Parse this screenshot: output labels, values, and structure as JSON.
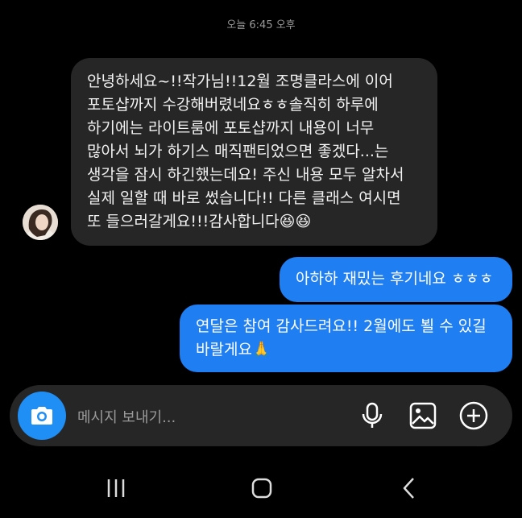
{
  "header": {
    "timestamp": "오늘 6:45 오후"
  },
  "messages": {
    "incoming": {
      "text": "안녕하세요~!!작가님!!12월 조명클라스에 이어\n포토샵까지 수강해버렸네요ㅎㅎ솔직히 하루에\n하기에는 라이트룸에 포토샵까지 내용이 너무\n많아서 뇌가 하기스 매직팬티었으면 좋겠다...는\n생각을 잠시 하긴했는데요! 주신 내용 모두 알차서\n실제 일할 때 바로 썼습니다!! 다른 클래스 여시면\n또 들으러갈게요!!!감사합니다😆😆"
    },
    "outgoing": [
      {
        "text": "아하하 재밌는 후기네요 ㅎㅎㅎ"
      },
      {
        "text": "연달은 참여 감사드려요!! 2월에도 뵐 수 있길\n바랄게요🙏"
      }
    ]
  },
  "composer": {
    "placeholder": "메시지 보내기...",
    "icons": [
      "camera-icon",
      "microphone-icon",
      "gallery-icon",
      "plus-icon"
    ],
    "accent": "#1f8ef5"
  },
  "colors": {
    "outgoing_bubble": "#1f7ef2",
    "incoming_bubble": "#262626"
  },
  "navbar": {
    "icons": [
      "recent-apps-icon",
      "home-icon",
      "back-icon"
    ]
  }
}
